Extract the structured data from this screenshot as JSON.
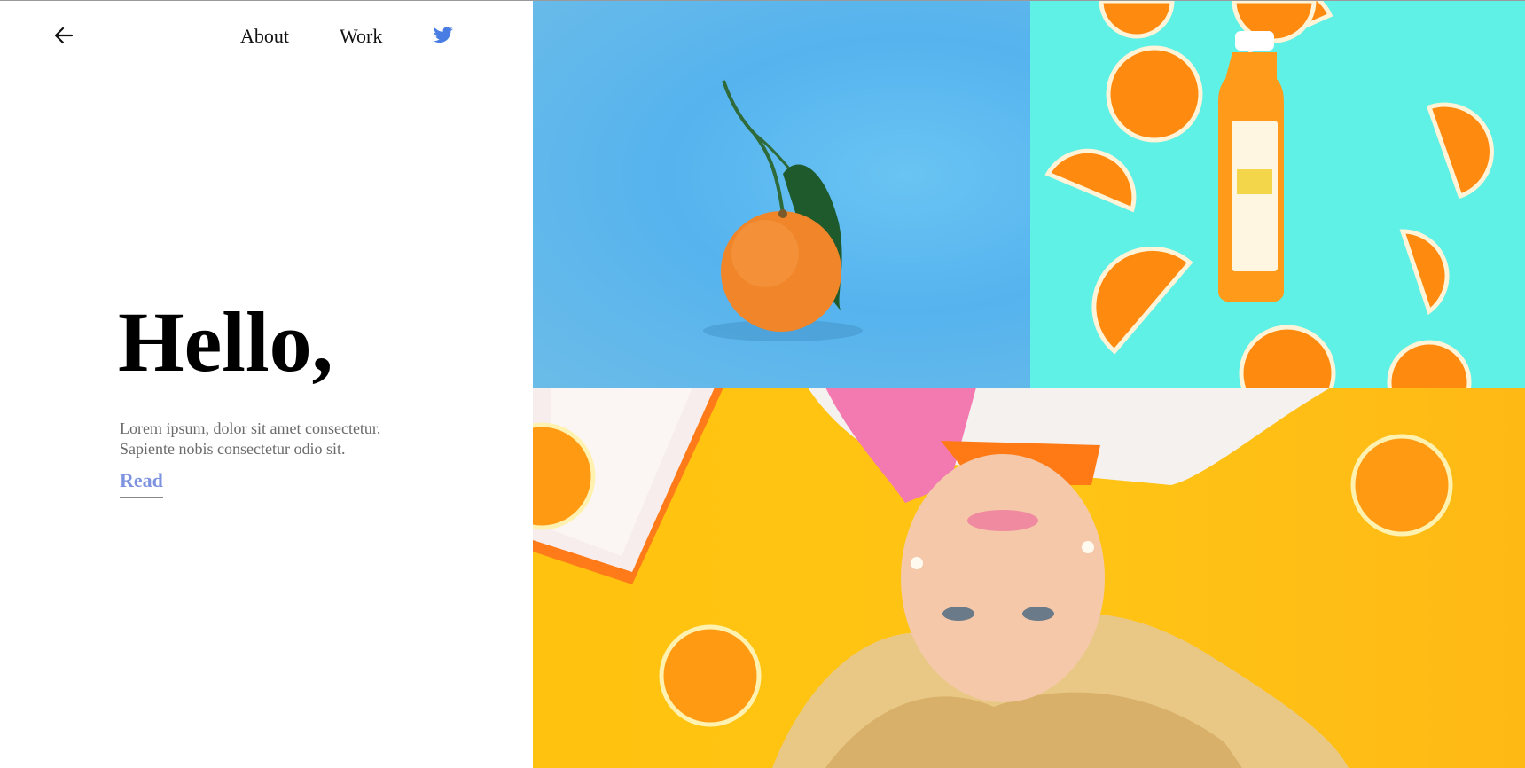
{
  "nav": {
    "back_icon": "arrow-left-icon",
    "about_label": "About",
    "work_label": "Work",
    "twitter_icon": "twitter-icon",
    "twitter_color": "#4a7de3"
  },
  "hero": {
    "heading": "Hello,",
    "description_line1": "Lorem ipsum, dolor sit amet consectetur.",
    "description_line2": "Sapiente nobis consectetur odio sit.",
    "read_label": "Read",
    "read_color": "#7e93e0"
  },
  "gallery": {
    "photos": [
      {
        "subject": "tangerine-with-leaf",
        "background": "#5ab8ef"
      },
      {
        "subject": "orange-juice-bottle-with-slices",
        "background": "#5ff0e6"
      },
      {
        "subject": "woman-lying-with-orange-slices",
        "background": "#ffc20e"
      }
    ]
  }
}
